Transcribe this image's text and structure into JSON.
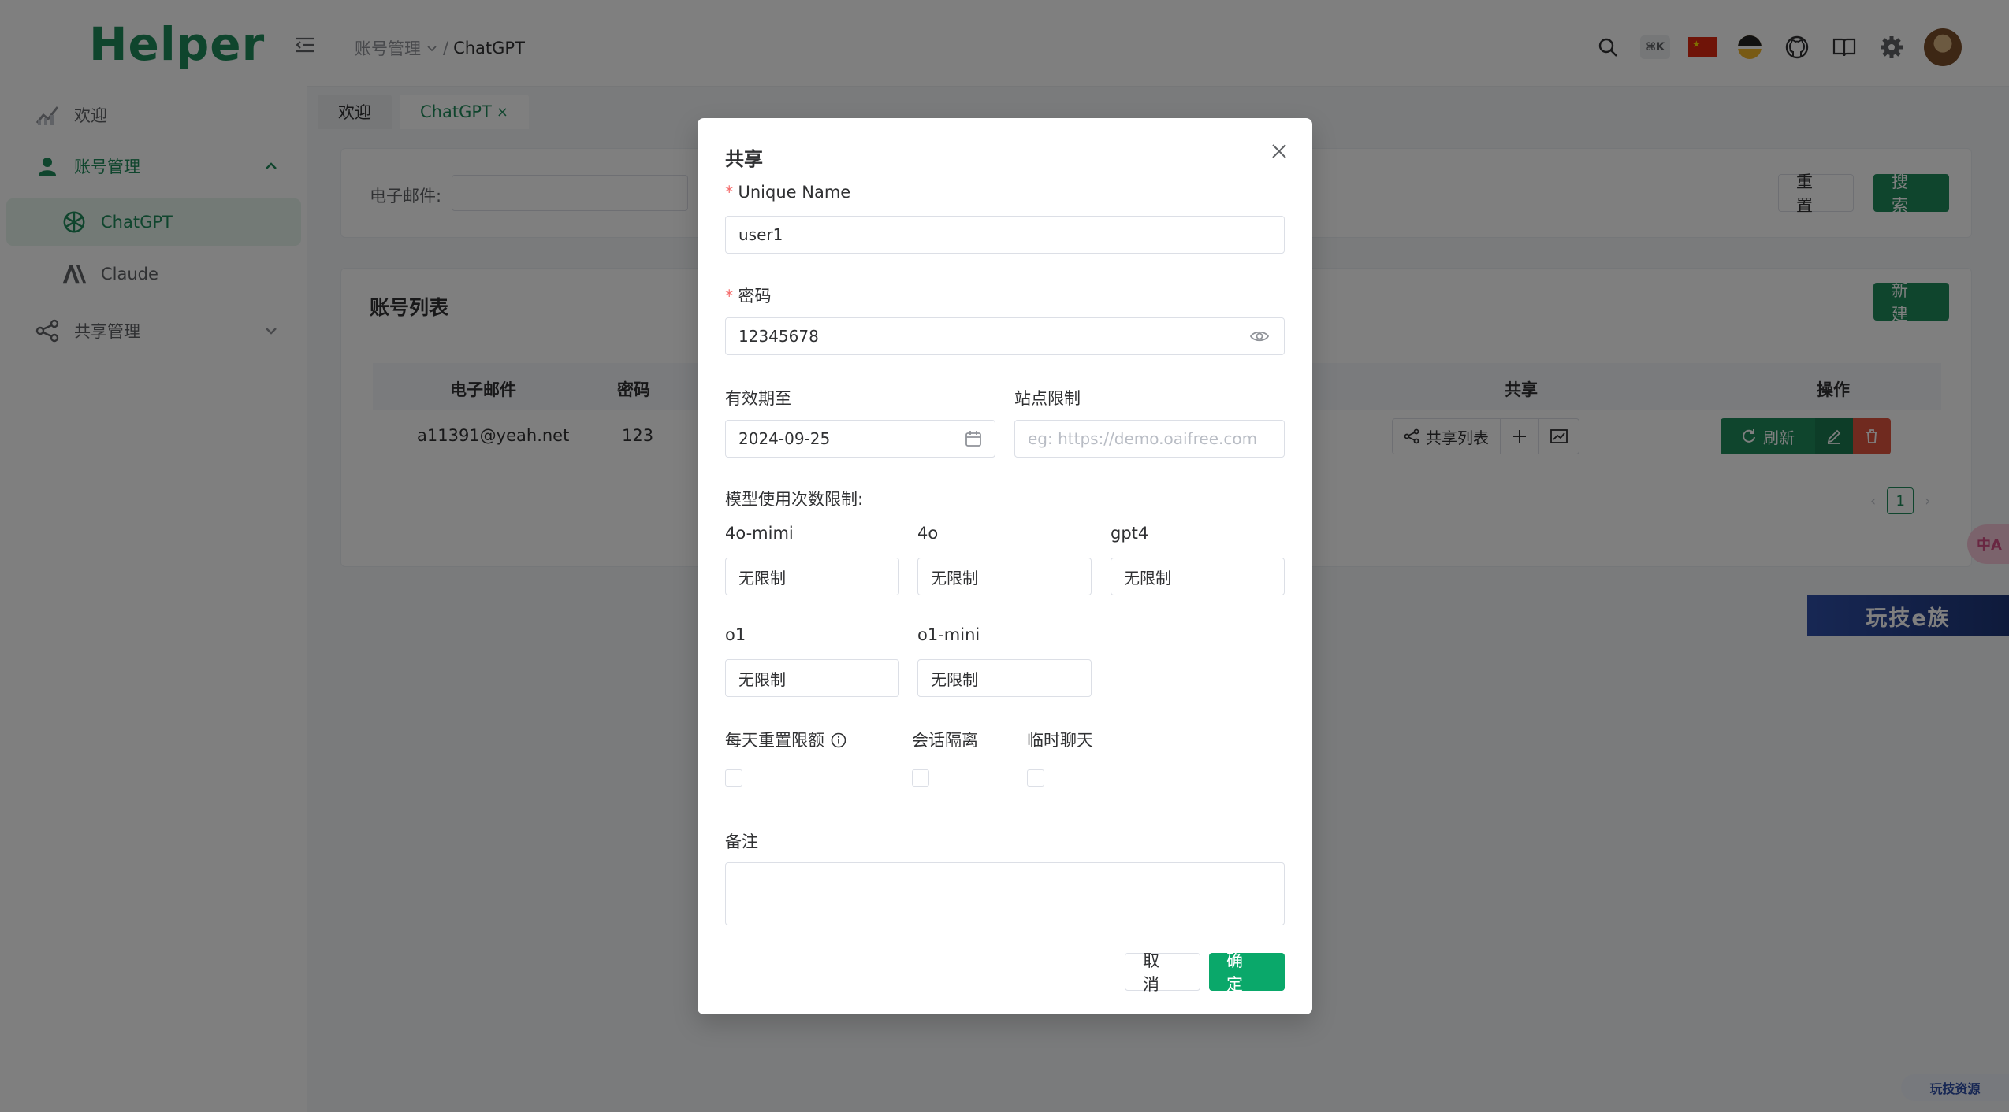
{
  "app": {
    "logo": "Helper"
  },
  "sidebar": {
    "items": [
      {
        "label": "欢迎"
      },
      {
        "label": "账号管理"
      },
      {
        "label": "ChatGPT"
      },
      {
        "label": "Claude"
      },
      {
        "label": "共享管理"
      }
    ]
  },
  "header": {
    "breadcrumb_parent": "账号管理",
    "breadcrumb_sep": "/",
    "breadcrumb_current": "ChatGPT",
    "kbd_hint": "⌘K"
  },
  "tabs": [
    {
      "label": "欢迎"
    },
    {
      "label": "ChatGPT",
      "close": "×"
    }
  ],
  "search": {
    "email_label": "电子邮件:",
    "reset_label": "重置",
    "search_label": "搜索"
  },
  "list": {
    "title": "账号列表",
    "new_label": "新建",
    "columns": {
      "email": "电子邮件",
      "password": "密码",
      "share": "共享",
      "actions": "操作"
    },
    "rows": [
      {
        "email": "a11391@yeah.net",
        "password": "123",
        "share_list": "共享列表",
        "refresh": "刷新"
      }
    ],
    "pager": {
      "current": "1"
    }
  },
  "watermark": {
    "big": "玩技e族",
    "small": "玩技资源",
    "translate": "中A"
  },
  "modal": {
    "title": "共享",
    "unique_name_label": "Unique Name",
    "unique_name_value": "user1",
    "password_label": "密码",
    "password_value": "12345678",
    "expire_label": "有效期至",
    "expire_value": "2024-09-25",
    "site_label": "站点限制",
    "site_placeholder": "eg: https://demo.oaifree.com",
    "model_limit_label": "模型使用次数限制:",
    "models": [
      {
        "label": "4o-mimi",
        "value": "无限制"
      },
      {
        "label": "4o",
        "value": "无限制"
      },
      {
        "label": "gpt4",
        "value": "无限制"
      },
      {
        "label": "o1",
        "value": "无限制"
      },
      {
        "label": "o1-mini",
        "value": "无限制"
      }
    ],
    "daily_reset_label": "每天重置限额",
    "session_isolation_label": "会话隔离",
    "temp_chat_label": "临时聊天",
    "remark_label": "备注",
    "remark_value": "",
    "cancel_label": "取消",
    "confirm_label": "确定"
  },
  "colors": {
    "brand": "#1f8a5b",
    "danger": "#e0543f",
    "required": "#f56c6c"
  }
}
